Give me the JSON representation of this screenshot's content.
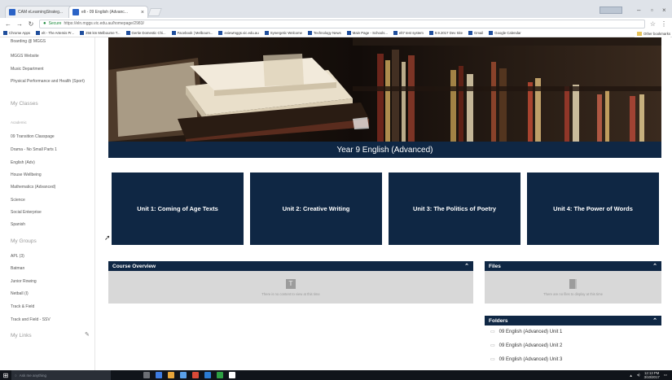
{
  "browser": {
    "tabs": [
      {
        "title": "CAM eLearningStrateg..."
      },
      {
        "title": "elt - 09 English (Advanc..."
      }
    ],
    "secure_label": "Secure",
    "url": "https://eln.mggs.vic.edu.au/homepage/2983/",
    "bookmarks": [
      "Chrome Apps",
      "elt - The Artemis Pr...",
      "256 km Melbourne T...",
      "Gertie Domestic Chi...",
      "Facebook | Melbourn...",
      "eviewmggs.vic.edu.au",
      "Synergetic Welcome",
      "Technology News",
      "Main Page - Schools...",
      "elt7 test system",
      "9.9.2017 Dev Site",
      "Gmail",
      "Google Calendar"
    ],
    "other_bookmarks": "Other bookmarks"
  },
  "sidebar": {
    "top_links": [
      "Boarding @ MGGS",
      "MGGS Website",
      "Music Department",
      "Physical Performance and Health (Sport)"
    ],
    "my_classes_heading": "My Classes",
    "academic_label": "Academic",
    "classes": [
      "09 Transition Classpage",
      "Drama - No Small Parts 1",
      "English (Adv)",
      "House Wellbeing",
      "Mathematics (Advanced)",
      "Science",
      "Social Enterprise",
      "Spanish"
    ],
    "my_groups_heading": "My Groups",
    "groups": [
      "APL (3)",
      "Batman",
      "Junior Rowing",
      "Netball (I)",
      "Track & Field",
      "Track and Field - SSV"
    ],
    "my_links_heading": "My Links"
  },
  "course": {
    "title": "Year 9 English (Advanced)",
    "units": [
      "Unit 1: Coming of Age Texts",
      "Unit 2: Creative Writing",
      "Unit 3: The Politics of Poetry",
      "Unit 4: The Power of Words"
    ]
  },
  "panels": {
    "overview_title": "Course Overview",
    "overview_empty": "There is no content to view at this time",
    "files_title": "Files",
    "files_empty": "There are no files to display at this time",
    "folders_title": "Folders",
    "folders": [
      "09 English (Advanced) Unit 1",
      "09 English (Advanced) Unit 2",
      "09 English (Advanced) Unit 3"
    ]
  },
  "taskbar": {
    "search_placeholder": "Ask me anything",
    "time": "12:13 PM",
    "date": "3/10/2017"
  },
  "colors": {
    "navy": "#0f2744",
    "panel_grey": "#d8d8d8"
  }
}
